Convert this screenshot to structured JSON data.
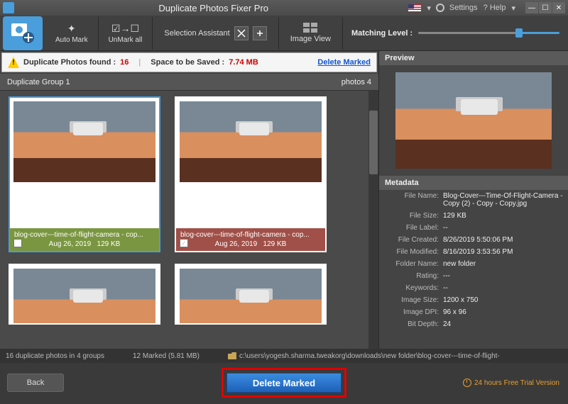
{
  "titlebar": {
    "title": "Duplicate Photos Fixer Pro",
    "settings": "Settings",
    "help": "? Help",
    "lang_dropdown": "▾"
  },
  "toolbar": {
    "auto_mark": "Auto Mark",
    "unmark_all": "UnMark all",
    "selection_assistant": "Selection Assistant",
    "image_view": "Image View",
    "matching_level": "Matching Level :"
  },
  "status": {
    "dup_label": "Duplicate Photos found :",
    "dup_count": "16",
    "space_label": "Space to be Saved :",
    "space_value": "7.74 MB",
    "delete_link": "Delete Marked"
  },
  "group": {
    "name": "Duplicate Group 1",
    "right": "photos 4"
  },
  "cards": [
    {
      "filename": "blog-cover---time-of-flight-camera - cop...",
      "date": "Aug 26, 2019",
      "size": "129 KB",
      "checked": false,
      "tone": "green"
    },
    {
      "filename": "blog-cover---time-of-flight-camera - cop...",
      "date": "Aug 26, 2019",
      "size": "129 KB",
      "checked": true,
      "tone": "red"
    }
  ],
  "preview": {
    "label": "Preview"
  },
  "metadata": {
    "label": "Metadata",
    "rows": [
      {
        "k": "File Name:",
        "v": "Blog-Cover---Time-Of-Flight-Camera - Copy (2) - Copy - Copy.jpg"
      },
      {
        "k": "File Size:",
        "v": "129 KB"
      },
      {
        "k": "File Label:",
        "v": "--"
      },
      {
        "k": "File Created:",
        "v": "8/26/2019 5:50:06 PM"
      },
      {
        "k": "File Modified:",
        "v": "8/16/2019 3:53:56 PM"
      },
      {
        "k": "Folder Name:",
        "v": "new folder"
      },
      {
        "k": "Rating:",
        "v": "---"
      },
      {
        "k": "Keywords:",
        "v": "--"
      },
      {
        "k": "Image Size:",
        "v": "1200 x 750"
      },
      {
        "k": "Image DPI:",
        "v": "96 x 96"
      },
      {
        "k": "Bit Depth:",
        "v": "24"
      }
    ]
  },
  "bottom": {
    "summary": "16 duplicate photos in 4 groups",
    "marked": "12 Marked (5.81 MB)",
    "path": "c:\\users\\yogesh.sharma.tweakorg\\downloads\\new folder\\blog-cover---time-of-flight-"
  },
  "footer": {
    "back": "Back",
    "delete": "Delete Marked",
    "trial": "24 hours Free Trial Version"
  }
}
